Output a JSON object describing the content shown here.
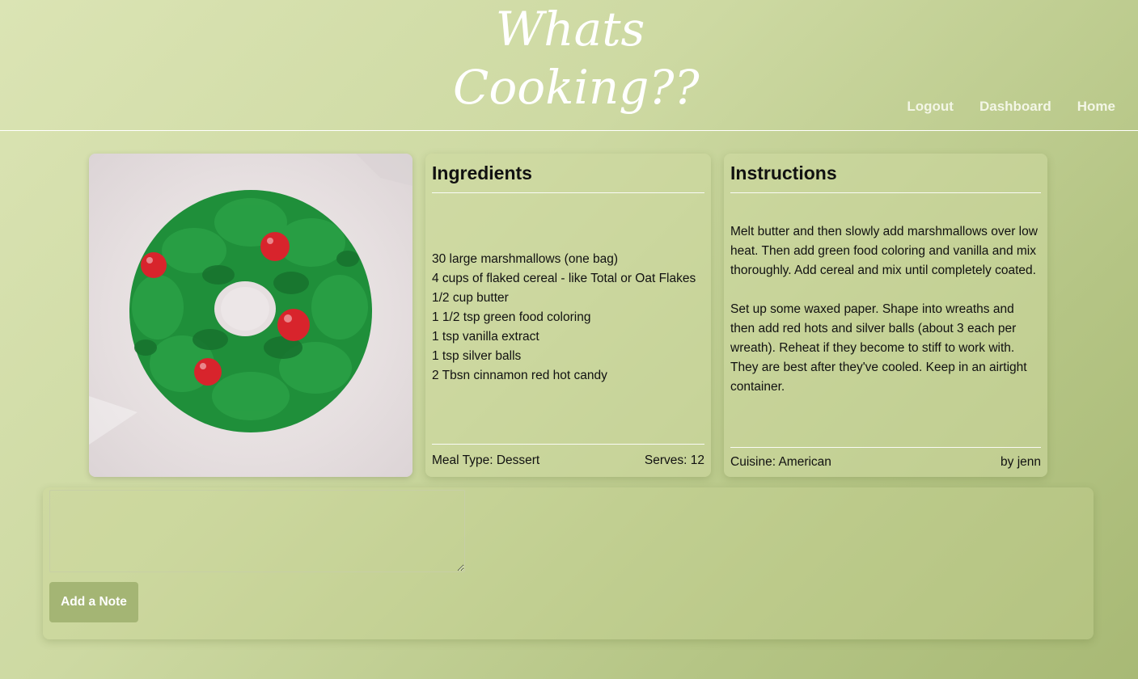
{
  "header": {
    "logo_line1": "Whats",
    "logo_line2": "Cooking??",
    "nav": [
      "Logout",
      "Dashboard",
      "Home"
    ]
  },
  "recipe": {
    "ingredients_title": "Ingredients",
    "ingredients": [
      "30 large marshmallows (one bag)",
      "4 cups of flaked cereal - like Total or Oat Flakes",
      "1/2 cup butter",
      "1 1/2 tsp green food coloring",
      "1 tsp vanilla extract",
      "1 tsp silver balls",
      "2 Tbsn cinnamon red hot candy"
    ],
    "meal_type": "Meal Type: Dessert",
    "serves": "Serves: 12",
    "instructions_title": "Instructions",
    "instructions_p1": "Melt butter and then slowly add marshmallows over low heat. Then add green food coloring and vanilla and mix thoroughly. Add cereal and mix until completely coated.",
    "instructions_p2": "Set up some waxed paper. Shape into wreaths and then add red hots and silver balls (about 3 each per wreath). Reheat if they become to stiff to work with. They are best after they've cooled. Keep in an airtight container.",
    "cuisine": "Cuisine: American",
    "author": "by jenn"
  },
  "notes": {
    "textarea_value": "",
    "button_label": "Add a Note"
  },
  "colors": {
    "button": "#a4b574",
    "wreath_green": "#1f8f3a",
    "candy_red": "#d8242c"
  }
}
